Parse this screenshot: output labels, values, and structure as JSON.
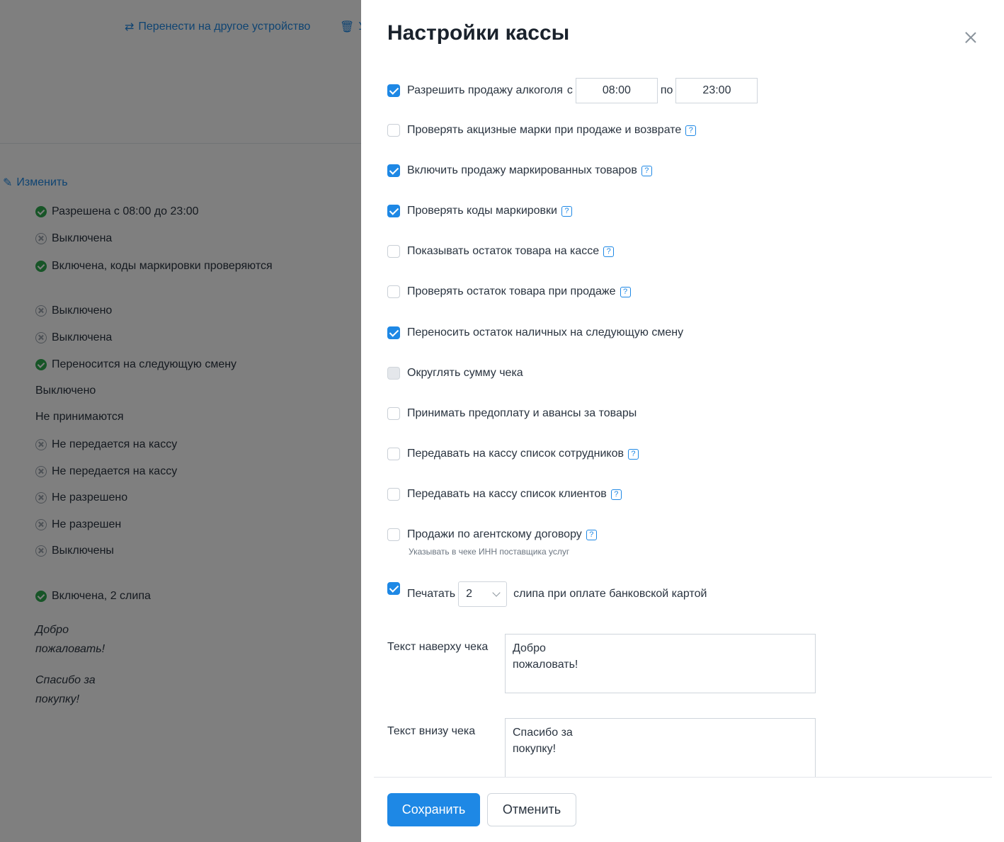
{
  "background": {
    "transfer_link": "Перенести на другое устройство",
    "delete_link_partial": "У",
    "edit_link": "Изменить",
    "rows": [
      {
        "icon": "check-circle-icon",
        "text": "Разрешена с 08:00 до 23:00"
      },
      {
        "icon": "x-circle-icon",
        "text": "Выключена"
      },
      {
        "icon": "check-circle-icon",
        "text": "Включена, коды маркировки проверяются"
      },
      {
        "icon": "x-circle-icon",
        "text": "Выключено"
      },
      {
        "icon": "x-circle-icon",
        "text": "Выключена"
      },
      {
        "icon": "check-circle-icon",
        "text": "Переносится на следующую смену"
      },
      {
        "icon": "",
        "text": "Выключено"
      },
      {
        "icon": "",
        "text": "Не принимаются"
      },
      {
        "icon": "x-circle-icon",
        "text": "Не передается на кассу"
      },
      {
        "icon": "x-circle-icon",
        "text": "Не передается на кассу"
      },
      {
        "icon": "x-circle-icon",
        "text": "Не разрешено"
      },
      {
        "icon": "x-circle-icon",
        "text": "Не разрешен"
      },
      {
        "icon": "x-circle-icon",
        "text": "Выключены"
      },
      {
        "icon": "check-circle-icon",
        "text": "Включена, 2 слипа"
      }
    ],
    "header_text": "Добро\nпожаловать!",
    "footer_text": "Спасибо за\nпокупку!"
  },
  "modal": {
    "title": "Настройки кассы",
    "alcohol": {
      "label": "Разрешить продажу алкоголя",
      "from_label": "с",
      "from": "08:00",
      "to_label": "по",
      "to": "23:00",
      "checked": true
    },
    "options": [
      {
        "label": "Проверять акцизные марки при продаже и возврате",
        "checked": false,
        "help": true
      },
      {
        "label": "Включить продажу маркированных товаров",
        "checked": true,
        "help": true
      },
      {
        "label": "Проверять коды маркировки",
        "checked": true,
        "help": true
      },
      {
        "label": "Показывать остаток товара на кассе",
        "checked": false,
        "help": true
      },
      {
        "label": "Проверять остаток товара при продаже",
        "checked": false,
        "help": true
      },
      {
        "label": "Переносить остаток наличных на следующую смену",
        "checked": true,
        "help": false
      },
      {
        "label": "Округлять сумму чека",
        "checked": false,
        "disabled": true,
        "help": false
      },
      {
        "label": "Принимать предоплату и авансы за товары",
        "checked": false,
        "help": false
      },
      {
        "label": "Передавать на кассу список сотрудников",
        "checked": false,
        "help": true
      },
      {
        "label": "Передавать на кассу список клиентов",
        "checked": false,
        "help": true
      },
      {
        "label": "Продажи по агентскому договору",
        "checked": false,
        "help": true
      }
    ],
    "agent_hint": "Указывать в чеке ИНН поставщика услуг",
    "slips": {
      "prefix": "Печатать",
      "value": "2",
      "suffix": "слипа при оплате банковской картой",
      "checked": true
    },
    "header_label": "Текст наверху чека",
    "header_value": "Добро\nпожаловать!",
    "footer_label": "Текст внизу чека",
    "footer_value": "Спасибо за\nпокупку!",
    "save_label": "Сохранить",
    "cancel_label": "Отменить",
    "help_glyph": "?",
    "colors": {
      "accent": "#1e88e5",
      "success": "#2eaa4f"
    }
  }
}
